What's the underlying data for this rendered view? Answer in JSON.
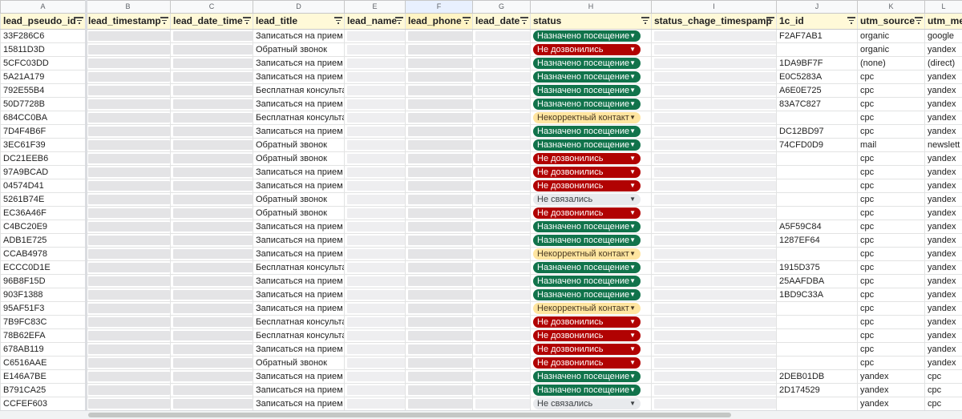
{
  "columns": [
    {
      "letter": "A",
      "field": "lead_pseudo_id"
    },
    {
      "letter": "B",
      "field": "lead_timestamp"
    },
    {
      "letter": "C",
      "field": "lead_date_time"
    },
    {
      "letter": "D",
      "field": "lead_title"
    },
    {
      "letter": "E",
      "field": "lead_name"
    },
    {
      "letter": "F",
      "field": "lead_phone"
    },
    {
      "letter": "G",
      "field": "lead_date"
    },
    {
      "letter": "H",
      "field": "status"
    },
    {
      "letter": "I",
      "field": "status_chage_timespamp"
    },
    {
      "letter": "J",
      "field": "1c_id"
    },
    {
      "letter": "K",
      "field": "utm_source"
    },
    {
      "letter": "L",
      "field": "utm_me"
    }
  ],
  "colors": {
    "header_bg": "#fff9d8",
    "status_green": "#11734b",
    "status_red": "#b10202",
    "status_yellow": "#ffe5a0",
    "status_gray": "#e8eaed"
  },
  "rows": [
    {
      "id": "33F286C6",
      "title": "Записаться на прием",
      "status": "Назначено посещение",
      "status_type": "green",
      "c1": "F2AF7AB1",
      "utm_source": "organic",
      "utm_medium": "google"
    },
    {
      "id": "15811D3D",
      "title": "Обратный звонок",
      "status": "Не дозвонились",
      "status_type": "red",
      "c1": "",
      "utm_source": "organic",
      "utm_medium": "yandex"
    },
    {
      "id": "5CFC03DD",
      "title": "Записаться на прием",
      "status": "Назначено посещение",
      "status_type": "green",
      "c1": "1DA9BF7F",
      "utm_source": "(none)",
      "utm_medium": "(direct)"
    },
    {
      "id": "5A21A179",
      "title": "Записаться на прием",
      "status": "Назначено посещение",
      "status_type": "green",
      "c1": "E0C5283A",
      "utm_source": "cpc",
      "utm_medium": "yandex"
    },
    {
      "id": "792E55B4",
      "title": "Бесплатная консульта",
      "status": "Назначено посещение",
      "status_type": "green",
      "c1": "A6E0E725",
      "utm_source": "cpc",
      "utm_medium": "yandex"
    },
    {
      "id": "50D7728B",
      "title": "Записаться на прием",
      "status": "Назначено посещение",
      "status_type": "green",
      "c1": "83A7C827",
      "utm_source": "cpc",
      "utm_medium": "yandex"
    },
    {
      "id": "684CC0BA",
      "title": "Бесплатная консульта",
      "status": "Некорректный контакт",
      "status_type": "yellow",
      "c1": "",
      "utm_source": "cpc",
      "utm_medium": "yandex"
    },
    {
      "id": "7D4F4B6F",
      "title": "Записаться на прием",
      "status": "Назначено посещение",
      "status_type": "green",
      "c1": "DC12BD97",
      "utm_source": "cpc",
      "utm_medium": "yandex"
    },
    {
      "id": "3EC61F39",
      "title": "Обратный звонок",
      "status": "Назначено посещение",
      "status_type": "green",
      "c1": "74CFD0D9",
      "utm_source": "mail",
      "utm_medium": "newslett"
    },
    {
      "id": "DC21EEB6",
      "title": "Обратный звонок",
      "status": "Не дозвонились",
      "status_type": "red",
      "c1": "",
      "utm_source": "cpc",
      "utm_medium": "yandex"
    },
    {
      "id": "97A9BCAD",
      "title": "Записаться на прием",
      "status": "Не дозвонились",
      "status_type": "red",
      "c1": "",
      "utm_source": "cpc",
      "utm_medium": "yandex"
    },
    {
      "id": "04574D41",
      "title": "Записаться на прием",
      "status": "Не дозвонились",
      "status_type": "red",
      "c1": "",
      "utm_source": "cpc",
      "utm_medium": "yandex"
    },
    {
      "id": "5261B74E",
      "title": "Обратный звонок",
      "status": "Не связались",
      "status_type": "gray",
      "c1": "",
      "utm_source": "cpc",
      "utm_medium": "yandex"
    },
    {
      "id": "EC36A46F",
      "title": "Обратный звонок",
      "status": "Не дозвонились",
      "status_type": "red",
      "c1": "",
      "utm_source": "cpc",
      "utm_medium": "yandex"
    },
    {
      "id": "C4BC20E9",
      "title": "Записаться на прием",
      "status": "Назначено посещение",
      "status_type": "green",
      "c1": "A5F59C84",
      "utm_source": "cpc",
      "utm_medium": "yandex"
    },
    {
      "id": "ADB1E725",
      "title": "Записаться на прием",
      "status": "Назначено посещение",
      "status_type": "green",
      "c1": "1287EF64",
      "utm_source": "cpc",
      "utm_medium": "yandex"
    },
    {
      "id": "CCAB4978",
      "title": "Записаться на прием",
      "status": "Некорректный контакт",
      "status_type": "yellow",
      "c1": "",
      "utm_source": "cpc",
      "utm_medium": "yandex"
    },
    {
      "id": "ECCC0D1E",
      "title": "Бесплатная консульта",
      "status": "Назначено посещение",
      "status_type": "green",
      "c1": "1915D375",
      "utm_source": "cpc",
      "utm_medium": "yandex"
    },
    {
      "id": "96B8F15D",
      "title": "Записаться на прием",
      "status": "Назначено посещение",
      "status_type": "green",
      "c1": "25AAFDBA",
      "utm_source": "cpc",
      "utm_medium": "yandex"
    },
    {
      "id": "903F1388",
      "title": "Записаться на прием",
      "status": "Назначено посещение",
      "status_type": "green",
      "c1": "1BD9C33A",
      "utm_source": "cpc",
      "utm_medium": "yandex"
    },
    {
      "id": "95AF51F3",
      "title": "Записаться на прием",
      "status": "Некорректный контакт",
      "status_type": "yellow",
      "c1": "",
      "utm_source": "cpc",
      "utm_medium": "yandex"
    },
    {
      "id": "7B9FC83C",
      "title": "Бесплатная консульта",
      "status": "Не дозвонились",
      "status_type": "red",
      "c1": "",
      "utm_source": "cpc",
      "utm_medium": "yandex"
    },
    {
      "id": "78B62EFA",
      "title": "Бесплатная консульта",
      "status": "Не дозвонились",
      "status_type": "red",
      "c1": "",
      "utm_source": "cpc",
      "utm_medium": "yandex"
    },
    {
      "id": "678AB119",
      "title": "Записаться на прием",
      "status": "Не дозвонились",
      "status_type": "red",
      "c1": "",
      "utm_source": "cpc",
      "utm_medium": "yandex"
    },
    {
      "id": "C6516AAE",
      "title": "Обратный звонок",
      "status": "Не дозвонились",
      "status_type": "red",
      "c1": "",
      "utm_source": "cpc",
      "utm_medium": "yandex"
    },
    {
      "id": "E146A7BE",
      "title": "Записаться на прием",
      "status": "Назначено посещение",
      "status_type": "green",
      "c1": "2DEB01DB",
      "utm_source": "yandex",
      "utm_medium": "cpc"
    },
    {
      "id": "B791CA25",
      "title": "Записаться на прием",
      "status": "Назначено посещение",
      "status_type": "green",
      "c1": "2D174529",
      "utm_source": "yandex",
      "utm_medium": "cpc"
    },
    {
      "id": "CCFEF603",
      "title": "Записаться на прием",
      "status": "Не связались",
      "status_type": "gray",
      "c1": "",
      "utm_source": "yandex",
      "utm_medium": "cpc"
    }
  ]
}
